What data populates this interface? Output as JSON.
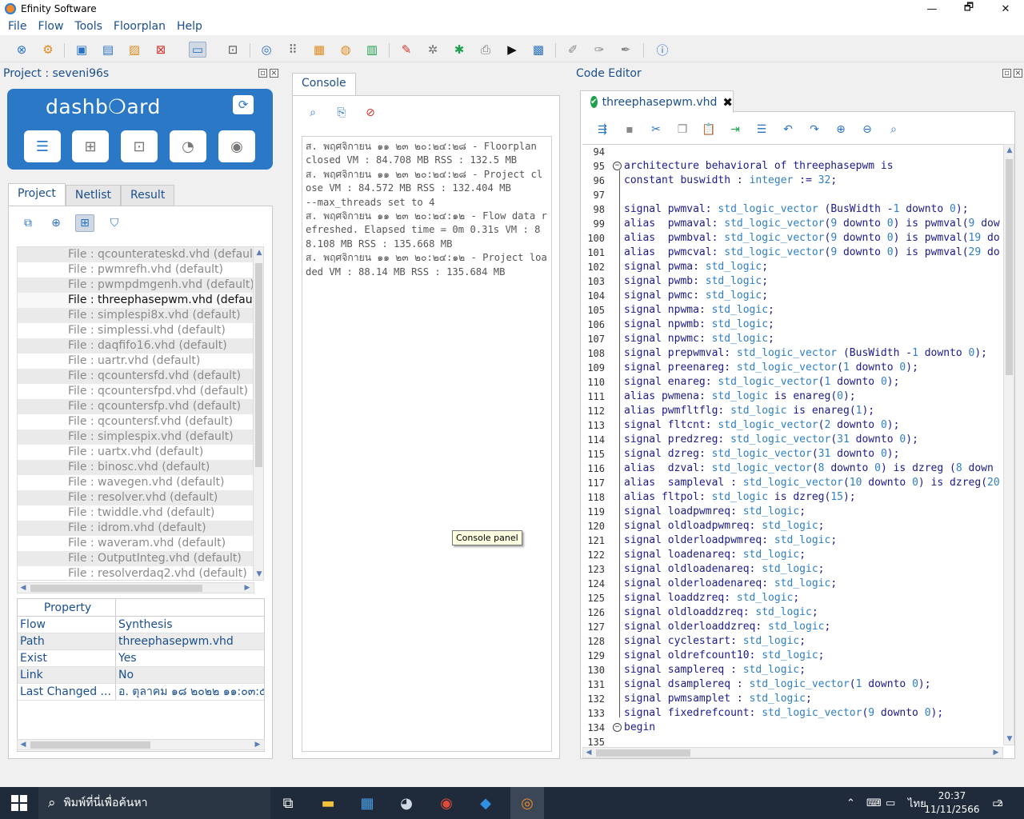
{
  "window": {
    "title": "Efinity Software",
    "minimize": "—",
    "maximize": "🗗",
    "close": "✕"
  },
  "menu": [
    "File",
    "Flow",
    "Tools",
    "Floorplan",
    "Help"
  ],
  "project_panel": {
    "title": "Project : seveni96s"
  },
  "dashboard": {
    "logo": "dashb❍ard"
  },
  "project_tabs": [
    "Project",
    "Netlist",
    "Result"
  ],
  "files": [
    "File : qcounterateskd.vhd (default)",
    "File : pwmrefh.vhd (default)",
    "File : pwmpdmgenh.vhd (default)",
    "File : threephasepwm.vhd (default)",
    "File : simplespi8x.vhd (default)",
    "File : simplessi.vhd (default)",
    "File : daqfifo16.vhd (default)",
    "File : uartr.vhd (default)",
    "File : qcountersfd.vhd (default)",
    "File : qcountersfpd.vhd (default)",
    "File : qcountersfp.vhd (default)",
    "File : qcountersf.vhd (default)",
    "File : simplespix.vhd (default)",
    "File : uartx.vhd (default)",
    "File : binosc.vhd (default)",
    "File : wavegen.vhd (default)",
    "File : resolver.vhd (default)",
    "File : twiddle.vhd (default)",
    "File : idrom.vhd (default)",
    "File : waveram.vhd (default)",
    "File : OutputInteg.vhd (default)",
    "File : resolverdaq2.vhd (default)"
  ],
  "properties": {
    "header": "Property",
    "rows": [
      {
        "key": "Flow",
        "value": "Synthesis"
      },
      {
        "key": "Path",
        "value": "threephasepwm.vhd"
      },
      {
        "key": "Exist",
        "value": "Yes"
      },
      {
        "key": "Link",
        "value": "No"
      },
      {
        "key": "Last Changed ...",
        "value": "อ. ตุลาคม ๑๘ ๒๐๒๒ ๑๑:๐๓:๕"
      }
    ]
  },
  "console": {
    "tab": "Console",
    "lines": [
      "ส. พฤศจิกายน ๑๑ ๒๓ ๒๐:๒๔:๒๘ - Floorplan closed VM : 84.708 MB RSS : 132.5 MB",
      "ส. พฤศจิกายน ๑๑ ๒๓ ๒๐:๒๔:๒๘ - Project close VM : 84.572 MB RSS : 132.404 MB",
      "--max_threads set to 4",
      "ส. พฤศจิกายน ๑๑ ๒๓ ๒๐:๒๔:๑๒ - Flow data refreshed. Elapsed time = 0m 0.31s VM : 88.108 MB RSS : 135.668 MB",
      "ส. พฤศจิกายน ๑๑ ๒๓ ๒๐:๒๔:๑๒ - Project loaded VM : 88.14 MB RSS : 135.684 MB"
    ],
    "tooltip": "Console panel"
  },
  "editor": {
    "title": "Code Editor",
    "tab": "threephasepwm.vhd",
    "lines": [
      {
        "n": "94",
        "t": ""
      },
      {
        "n": "95",
        "t": "architecture behavioral of threephasepwm is"
      },
      {
        "n": "96",
        "t": "constant buswidth : integer := 32;"
      },
      {
        "n": "97",
        "t": ""
      },
      {
        "n": "98",
        "t": "signal pwmval: std_logic_vector (BusWidth -1 downto 0);"
      },
      {
        "n": "99",
        "t": "alias  pwmaval: std_logic_vector(9 downto 0) is pwmval(9 dow"
      },
      {
        "n": "100",
        "t": "alias  pwmbval: std_logic_vector(9 downto 0) is pwmval(19 do"
      },
      {
        "n": "101",
        "t": "alias  pwmcval: std_logic_vector(9 downto 0) is pwmval(29 do"
      },
      {
        "n": "102",
        "t": "signal pwma: std_logic;"
      },
      {
        "n": "103",
        "t": "signal pwmb: std_logic;"
      },
      {
        "n": "104",
        "t": "signal pwmc: std_logic;"
      },
      {
        "n": "105",
        "t": "signal npwma: std_logic;"
      },
      {
        "n": "106",
        "t": "signal npwmb: std_logic;"
      },
      {
        "n": "107",
        "t": "signal npwmc: std_logic;"
      },
      {
        "n": "108",
        "t": "signal prepwmval: std_logic_vector (BusWidth -1 downto 0);"
      },
      {
        "n": "109",
        "t": "signal preenareg: std_logic_vector(1 downto 0);"
      },
      {
        "n": "110",
        "t": "signal enareg: std_logic_vector(1 downto 0);"
      },
      {
        "n": "111",
        "t": "alias pwmena: std_logic is enareg(0);"
      },
      {
        "n": "112",
        "t": "alias pwmfltflg: std_logic is enareg(1);"
      },
      {
        "n": "113",
        "t": "signal fltcnt: std_logic_vector(2 downto 0);"
      },
      {
        "n": "114",
        "t": "signal predzreg: std_logic_vector(31 downto 0);"
      },
      {
        "n": "115",
        "t": "signal dzreg: std_logic_vector(31 downto 0);"
      },
      {
        "n": "116",
        "t": "alias  dzval: std_logic_vector(8 downto 0) is dzreg (8 down"
      },
      {
        "n": "117",
        "t": "alias  sampleval : std_logic_vector(10 downto 0) is dzreg(20"
      },
      {
        "n": "118",
        "t": "alias fltpol: std_logic is dzreg(15);"
      },
      {
        "n": "119",
        "t": "signal loadpwmreq: std_logic;"
      },
      {
        "n": "120",
        "t": "signal oldloadpwmreq: std_logic;"
      },
      {
        "n": "121",
        "t": "signal olderloadpwmreq: std_logic;"
      },
      {
        "n": "122",
        "t": "signal loadenareq: std_logic;"
      },
      {
        "n": "123",
        "t": "signal oldloadenareq: std_logic;"
      },
      {
        "n": "124",
        "t": "signal olderloadenareq: std_logic;"
      },
      {
        "n": "125",
        "t": "signal loaddzreq: std_logic;"
      },
      {
        "n": "126",
        "t": "signal oldloaddzreq: std_logic;"
      },
      {
        "n": "127",
        "t": "signal olderloaddzreq: std_logic;"
      },
      {
        "n": "128",
        "t": "signal cyclestart: std_logic;"
      },
      {
        "n": "129",
        "t": "signal oldrefcount10: std_logic;"
      },
      {
        "n": "130",
        "t": "signal samplereq : std_logic;"
      },
      {
        "n": "131",
        "t": "signal dsamplereq : std_logic_vector(1 downto 0);"
      },
      {
        "n": "132",
        "t": "signal pwmsamplet : std_logic;"
      },
      {
        "n": "133",
        "t": "signal fixedrefcount: std_logic_vector(9 downto 0);"
      },
      {
        "n": "134",
        "t": "begin"
      },
      {
        "n": "135",
        "t": ""
      }
    ]
  },
  "taskbar": {
    "search_placeholder": "พิมพ์ที่นี่เพื่อค้นหา",
    "lang": "ไทย",
    "time": "20:37",
    "date": "11/11/2566",
    "notifications": "2"
  }
}
